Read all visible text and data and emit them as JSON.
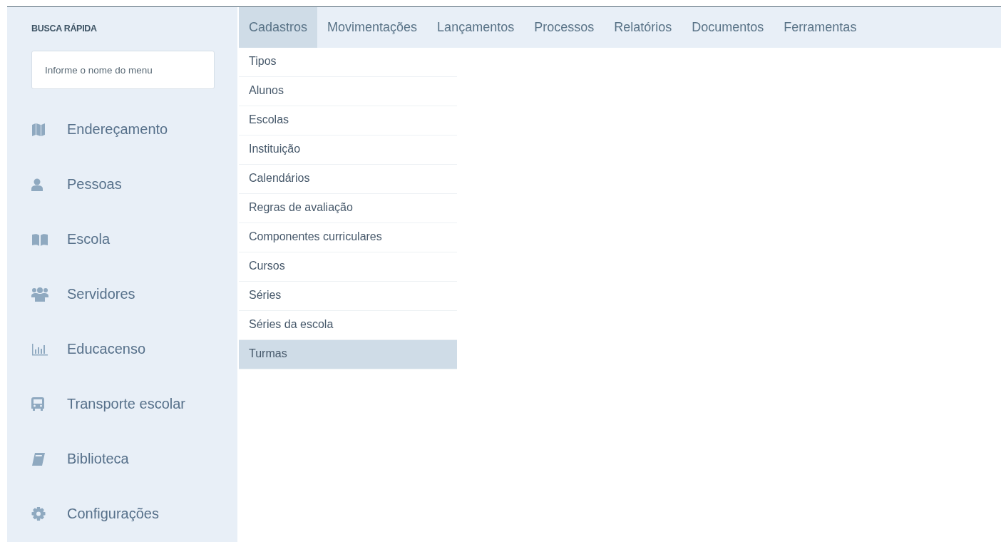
{
  "sidebar": {
    "search_heading": "BUSCA RÁPIDA",
    "search": {
      "placeholder": "Informe o nome do menu"
    },
    "items": [
      {
        "label": "Endereçamento"
      },
      {
        "label": "Pessoas"
      },
      {
        "label": "Escola"
      },
      {
        "label": "Servidores"
      },
      {
        "label": "Educacenso"
      },
      {
        "label": "Transporte escolar"
      },
      {
        "label": "Biblioteca"
      },
      {
        "label": "Configurações"
      }
    ]
  },
  "menu_bar": {
    "items": [
      {
        "label": "Cadastros",
        "selected": true
      },
      {
        "label": "Movimentações",
        "selected": false
      },
      {
        "label": "Lançamentos",
        "selected": false
      },
      {
        "label": "Processos",
        "selected": false
      },
      {
        "label": "Relatórios",
        "selected": false
      },
      {
        "label": "Documentos",
        "selected": false
      },
      {
        "label": "Ferramentas",
        "selected": false
      }
    ]
  },
  "dropdown": {
    "items": [
      {
        "label": "Tipos",
        "selected": false
      },
      {
        "label": "Alunos",
        "selected": false
      },
      {
        "label": "Escolas",
        "selected": false
      },
      {
        "label": "Instituição",
        "selected": false
      },
      {
        "label": "Calendários",
        "selected": false
      },
      {
        "label": "Regras de avaliação",
        "selected": false
      },
      {
        "label": "Componentes curriculares",
        "selected": false
      },
      {
        "label": "Cursos",
        "selected": false
      },
      {
        "label": "Séries",
        "selected": false
      },
      {
        "label": "Séries da escola",
        "selected": false
      },
      {
        "label": "Turmas",
        "selected": true
      }
    ]
  }
}
